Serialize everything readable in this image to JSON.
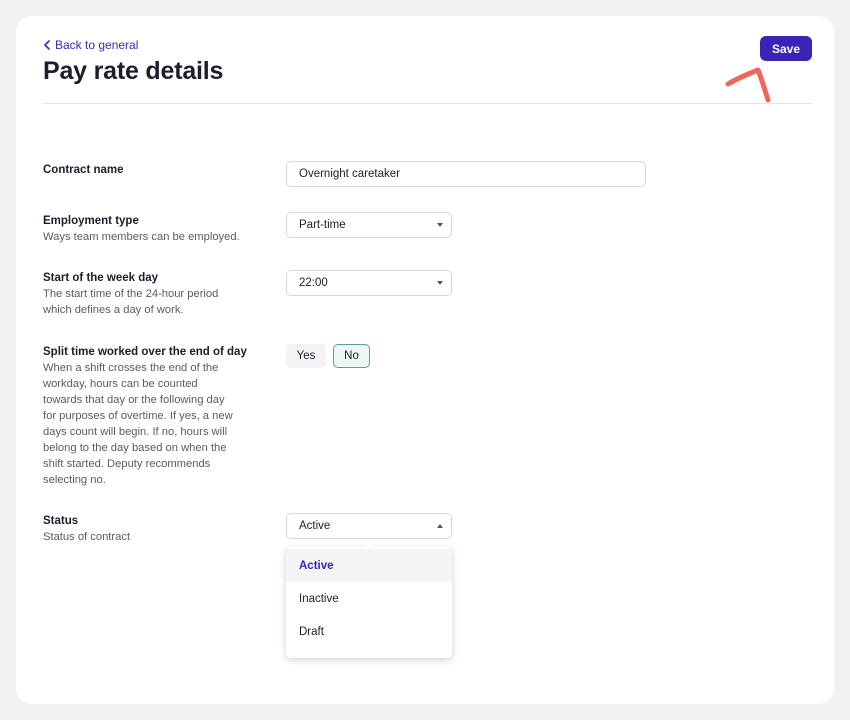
{
  "header": {
    "back_label": "Back to general",
    "title": "Pay rate details",
    "save_label": "Save"
  },
  "fields": {
    "contract_name": {
      "title": "Contract name",
      "value": "Overnight caretaker"
    },
    "employment_type": {
      "title": "Employment type",
      "description": "Ways team members can be employed.",
      "value": "Part-time"
    },
    "week_start": {
      "title": "Start of the week day",
      "description_lines": [
        "The start time of the 24-hour period",
        "which defines a day of work."
      ],
      "value": "22:00"
    },
    "split_time": {
      "title": "Split time worked over the end of day",
      "description_lines": [
        "When a shift crosses the end of the",
        "workday, hours can be counted",
        "towards that day or the following day",
        "for purposes of overtime. If yes, a new",
        "days count will begin. If no, hours will",
        "belong to the day based on when the",
        "shift started. Deputy recommends",
        "selecting no."
      ],
      "yes_label": "Yes",
      "no_label": "No",
      "selected": "No"
    },
    "status": {
      "title": "Status",
      "description": "Status of contract",
      "value": "Active",
      "options": [
        "Active",
        "Inactive",
        "Draft"
      ]
    }
  },
  "colors": {
    "accent": "#3a24b5",
    "annotation": "#f2665a",
    "toggle_selected_border": "#4aa3a6"
  },
  "icons": {
    "back": "chevron-left-icon",
    "select": "caret-down-icon"
  }
}
